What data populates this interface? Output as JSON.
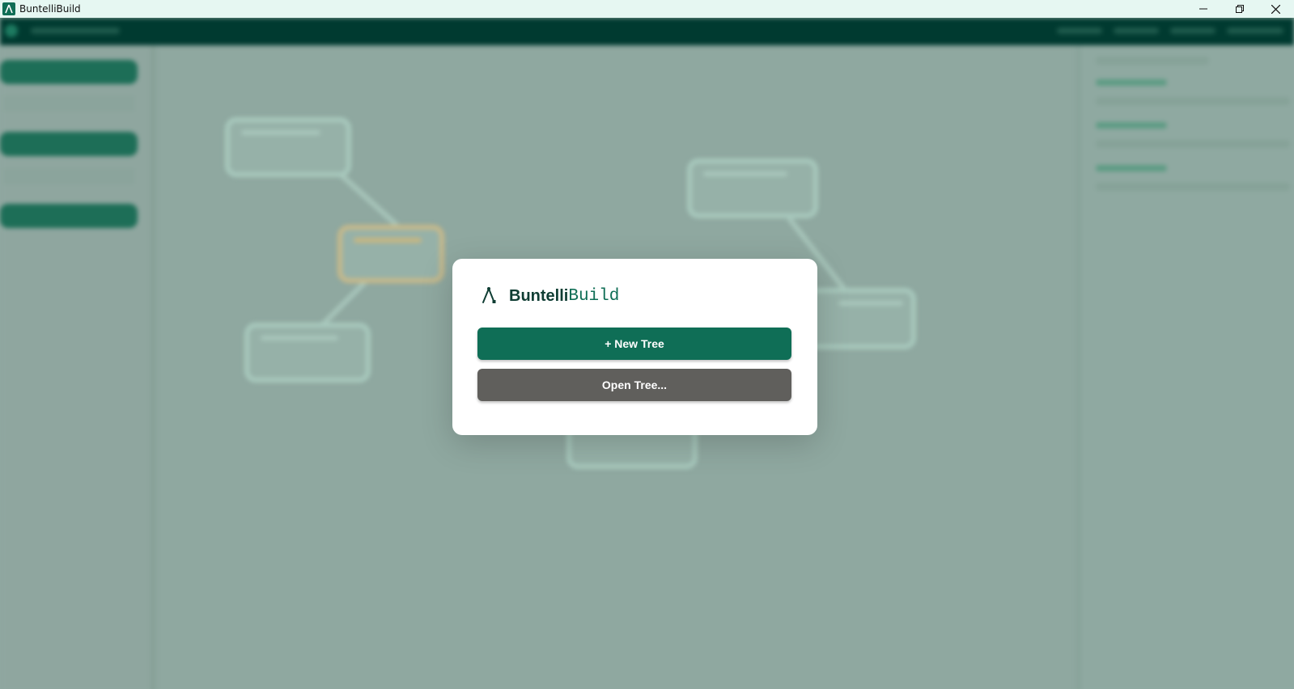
{
  "window": {
    "title": "BuntelliBuild",
    "controls": [
      "minimize-icon",
      "restore-icon",
      "close-icon"
    ]
  },
  "modal": {
    "brand_part1": "Buntelli",
    "brand_part2": "Build",
    "new_tree_label": "+ New Tree",
    "open_tree_label": "Open Tree..."
  },
  "colors": {
    "brand": "#0f6e56",
    "secondary_button": "#605f5c",
    "titlebar": "#e6f7f2"
  }
}
